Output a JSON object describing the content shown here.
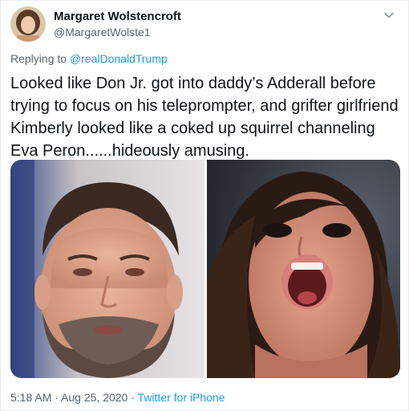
{
  "author": {
    "name": "Margaret Wolstencroft",
    "handle": "@MargaretWolste1"
  },
  "reply": {
    "prefix": "Replying to ",
    "mention": "@realDonaldTrump"
  },
  "tweet": {
    "text": "Looked like Don Jr. got into daddy’s Adderall before trying to focus on his teleprompter, and grifter girlfriend Kimberly looked like a coked up squirrel channeling Eva Peron......hideously amusing."
  },
  "footer": {
    "time": "5:18 AM",
    "separator": " · ",
    "date": "Aug 25, 2020",
    "source": "Twitter for iPhone"
  },
  "colors": {
    "link": "#1d9bf0",
    "muted": "#536471",
    "text": "#0f1419"
  },
  "icons": {
    "more": "chevron-down-icon"
  }
}
